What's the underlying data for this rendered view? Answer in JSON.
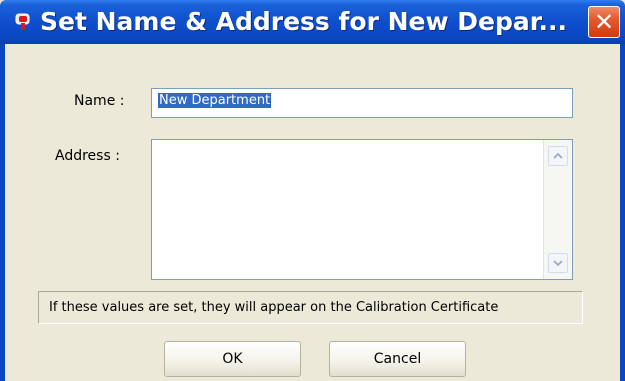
{
  "dialog": {
    "title": "Set Name & Address for New Depar...",
    "close_glyph": "✕",
    "icon": "app-icon"
  },
  "form": {
    "name_label": "Name :",
    "name_value": "New Department",
    "address_label": "Address :",
    "address_value": ""
  },
  "info_text": "If these values are set, they will appear on the Calibration Certificate",
  "buttons": {
    "ok_label": "OK",
    "cancel_label": "Cancel"
  },
  "colors": {
    "titlebar": "#0b46c2",
    "close": "#e45a2e",
    "selection": "#316ac5",
    "dialog_bg": "#ece9d8"
  }
}
